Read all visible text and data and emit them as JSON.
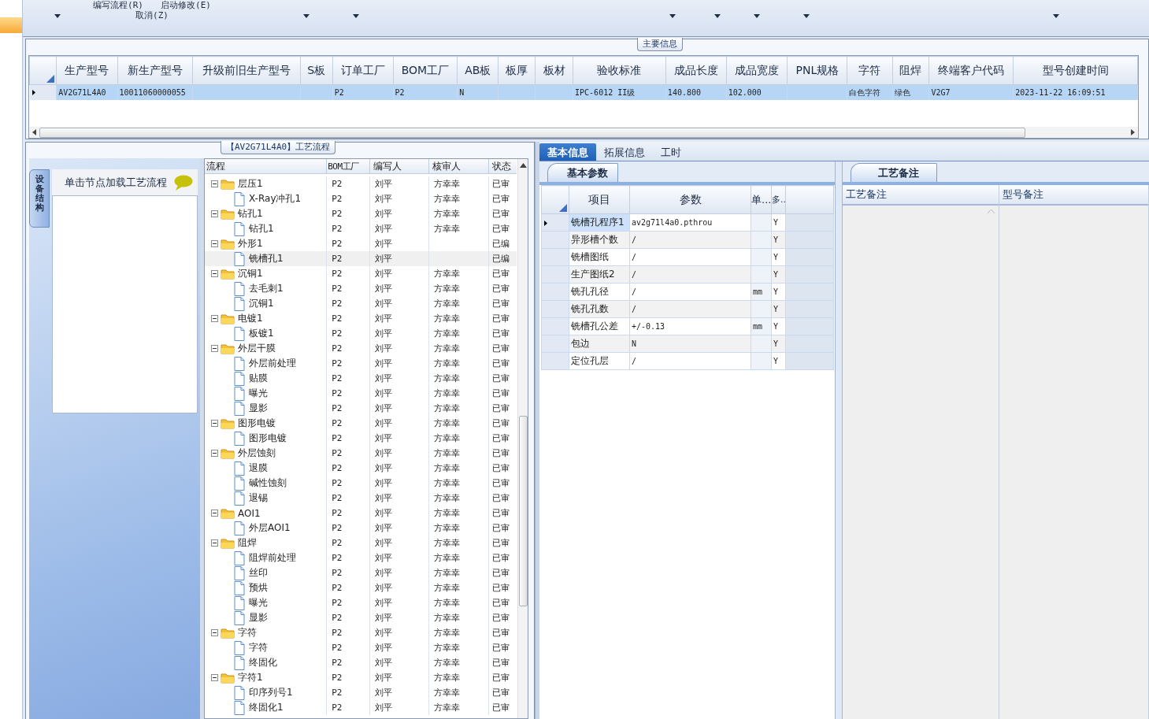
{
  "ribbon": {
    "buttons": [
      {
        "label": "编写流程(R)"
      },
      {
        "label": "启动修改(E)"
      },
      {
        "label": "取消(Z)"
      }
    ]
  },
  "main_info": {
    "title": "主要信息",
    "table": {
      "columns": [
        "生产型号",
        "新生产型号",
        "升级前旧生产型号",
        "S板",
        "订单工厂",
        "BOM工厂",
        "AB板",
        "板厚",
        "板材",
        "验收标准",
        "成品长度",
        "成品宽度",
        "PNL规格",
        "字符",
        "阻焊",
        "终端客户代码",
        "型号创建时间"
      ],
      "rows": [
        {
          "selected": true,
          "cells": [
            "AV2G71L4A0",
            "10011060000055",
            null,
            null,
            "P2",
            "P2",
            "N",
            null,
            null,
            "IPC-6012 II级",
            "140.800",
            "102.000",
            null,
            "白色字符",
            "绿色",
            "V2G7",
            "2023-11-22 16:09:51"
          ]
        }
      ]
    }
  },
  "process": {
    "title": "【AV2G71L4A0】工艺流程",
    "side_tab": "设备结构",
    "hint": "单击节点加载工艺流程",
    "columns": [
      "流程",
      "BOM工厂",
      "编写人",
      "核审人",
      "状态"
    ],
    "tree": [
      {
        "kind": "folder",
        "label": "层压1",
        "bom": "P2",
        "writer": "刘平",
        "reviewer": "方幸幸",
        "status": "已审",
        "expanded": true,
        "selected": false,
        "children": [
          {
            "kind": "file",
            "label": "X-Ray冲孔1",
            "bom": "P2",
            "writer": "刘平",
            "reviewer": "方幸幸",
            "status": "已审",
            "selected": false
          }
        ]
      },
      {
        "kind": "folder",
        "label": "钻孔1",
        "bom": "P2",
        "writer": "刘平",
        "reviewer": "方幸幸",
        "status": "已审",
        "expanded": true,
        "selected": false,
        "children": [
          {
            "kind": "file",
            "label": "钻孔1",
            "bom": "P2",
            "writer": "刘平",
            "reviewer": "方幸幸",
            "status": "已审",
            "selected": false
          }
        ]
      },
      {
        "kind": "folder",
        "label": "外形1",
        "bom": "P2",
        "writer": "刘平",
        "status": "已编",
        "expanded": true,
        "selected": false,
        "children": [
          {
            "kind": "file",
            "label": "铣槽孔1",
            "bom": "P2",
            "writer": "刘平",
            "status": "已编",
            "selected": true
          }
        ]
      },
      {
        "kind": "folder",
        "label": "沉铜1",
        "bom": "P2",
        "writer": "刘平",
        "reviewer": "方幸幸",
        "status": "已审",
        "expanded": true,
        "selected": false,
        "children": [
          {
            "kind": "file",
            "label": "去毛刺1",
            "bom": "P2",
            "writer": "刘平",
            "reviewer": "方幸幸",
            "status": "已审",
            "selected": false
          },
          {
            "kind": "file",
            "label": "沉铜1",
            "bom": "P2",
            "writer": "刘平",
            "reviewer": "方幸幸",
            "status": "已审",
            "selected": false
          }
        ]
      },
      {
        "kind": "folder",
        "label": "电镀1",
        "bom": "P2",
        "writer": "刘平",
        "reviewer": "方幸幸",
        "status": "已审",
        "expanded": true,
        "selected": false,
        "children": [
          {
            "kind": "file",
            "label": "板镀1",
            "bom": "P2",
            "writer": "刘平",
            "reviewer": "方幸幸",
            "status": "已审",
            "selected": false
          }
        ]
      },
      {
        "kind": "folder",
        "label": "外层干膜",
        "bom": "P2",
        "writer": "刘平",
        "reviewer": "方幸幸",
        "status": "已审",
        "expanded": true,
        "selected": false,
        "children": [
          {
            "kind": "file",
            "label": "外层前处理",
            "bom": "P2",
            "writer": "刘平",
            "reviewer": "方幸幸",
            "status": "已审",
            "selected": false
          },
          {
            "kind": "file",
            "label": "贴膜",
            "bom": "P2",
            "writer": "刘平",
            "reviewer": "方幸幸",
            "status": "已审",
            "selected": false
          },
          {
            "kind": "file",
            "label": "曝光",
            "bom": "P2",
            "writer": "刘平",
            "reviewer": "方幸幸",
            "status": "已审",
            "selected": false
          },
          {
            "kind": "file",
            "label": "显影",
            "bom": "P2",
            "writer": "刘平",
            "reviewer": "方幸幸",
            "status": "已审",
            "selected": false
          }
        ]
      },
      {
        "kind": "folder",
        "label": "图形电镀",
        "bom": "P2",
        "writer": "刘平",
        "reviewer": "方幸幸",
        "status": "已审",
        "expanded": true,
        "selected": false,
        "children": [
          {
            "kind": "file",
            "label": "图形电镀",
            "bom": "P2",
            "writer": "刘平",
            "reviewer": "方幸幸",
            "status": "已审",
            "selected": false
          }
        ]
      },
      {
        "kind": "folder",
        "label": "外层蚀刻",
        "bom": "P2",
        "writer": "刘平",
        "reviewer": "方幸幸",
        "status": "已审",
        "expanded": true,
        "selected": false,
        "children": [
          {
            "kind": "file",
            "label": "退膜",
            "bom": "P2",
            "writer": "刘平",
            "reviewer": "方幸幸",
            "status": "已审",
            "selected": false
          },
          {
            "kind": "file",
            "label": "碱性蚀刻",
            "bom": "P2",
            "writer": "刘平",
            "reviewer": "方幸幸",
            "status": "已审",
            "selected": false
          },
          {
            "kind": "file",
            "label": "退锡",
            "bom": "P2",
            "writer": "刘平",
            "reviewer": "方幸幸",
            "status": "已审",
            "selected": false
          }
        ]
      },
      {
        "kind": "folder",
        "label": "AOI1",
        "bom": "P2",
        "writer": "刘平",
        "reviewer": "方幸幸",
        "status": "已审",
        "expanded": true,
        "selected": false,
        "children": [
          {
            "kind": "file",
            "label": "外层AOI1",
            "bom": "P2",
            "writer": "刘平",
            "reviewer": "方幸幸",
            "status": "已审",
            "selected": false
          }
        ]
      },
      {
        "kind": "folder",
        "label": "阻焊",
        "bom": "P2",
        "writer": "刘平",
        "reviewer": "方幸幸",
        "status": "已审",
        "expanded": true,
        "selected": false,
        "children": [
          {
            "kind": "file",
            "label": "阻焊前处理",
            "bom": "P2",
            "writer": "刘平",
            "reviewer": "方幸幸",
            "status": "已审",
            "selected": false
          },
          {
            "kind": "file",
            "label": "丝印",
            "bom": "P2",
            "writer": "刘平",
            "reviewer": "方幸幸",
            "status": "已审",
            "selected": false
          },
          {
            "kind": "file",
            "label": "预烘",
            "bom": "P2",
            "writer": "刘平",
            "reviewer": "方幸幸",
            "status": "已审",
            "selected": false
          },
          {
            "kind": "file",
            "label": "曝光",
            "bom": "P2",
            "writer": "刘平",
            "reviewer": "方幸幸",
            "status": "已审",
            "selected": false
          },
          {
            "kind": "file",
            "label": "显影",
            "bom": "P2",
            "writer": "刘平",
            "reviewer": "方幸幸",
            "status": "已审",
            "selected": false
          }
        ]
      },
      {
        "kind": "folder",
        "label": "字符",
        "bom": "P2",
        "writer": "刘平",
        "reviewer": "方幸幸",
        "status": "已审",
        "expanded": true,
        "selected": false,
        "children": [
          {
            "kind": "file",
            "label": "字符",
            "bom": "P2",
            "writer": "刘平",
            "reviewer": "方幸幸",
            "status": "已审",
            "selected": false
          },
          {
            "kind": "file",
            "label": "终固化",
            "bom": "P2",
            "writer": "刘平",
            "reviewer": "方幸幸",
            "status": "已审",
            "selected": false
          }
        ]
      },
      {
        "kind": "folder",
        "label": "字符1",
        "bom": "P2",
        "writer": "刘平",
        "reviewer": "方幸幸",
        "status": "已审",
        "expanded": true,
        "selected": false,
        "children": [
          {
            "kind": "file",
            "label": "印序列号1",
            "bom": "P2",
            "writer": "刘平",
            "reviewer": "方幸幸",
            "status": "已审",
            "selected": false
          },
          {
            "kind": "file",
            "label": "终固化1",
            "bom": "P2",
            "writer": "刘平",
            "reviewer": "方幸幸",
            "status": "已审",
            "selected": false
          }
        ]
      }
    ]
  },
  "details": {
    "tabs": [
      {
        "label": "基本信息",
        "selected": true
      },
      {
        "label": "拓展信息",
        "selected": false
      },
      {
        "label": "工时",
        "selected": false
      }
    ],
    "params": {
      "tab": "基本参数",
      "columns": [
        "项目",
        "参数",
        "单...",
        "多.."
      ],
      "rows": [
        {
          "item": "铣槽孔程序1",
          "value": "av2g71l4a0.pthrou",
          "flag": "Y",
          "selected": true
        },
        {
          "item": "异形槽个数",
          "value": "/",
          "flag": "Y",
          "selected": false
        },
        {
          "item": "铣槽图纸",
          "value": "/",
          "flag": "Y",
          "selected": false
        },
        {
          "item": "生产图纸2",
          "value": "/",
          "flag": "Y",
          "selected": false
        },
        {
          "item": "铣孔孔径",
          "value": "/",
          "unit": "mm",
          "flag": "Y",
          "selected": false
        },
        {
          "item": "铣孔孔数",
          "value": "/",
          "flag": "Y",
          "selected": false
        },
        {
          "item": "铣槽孔公差",
          "value": "+/-0.13",
          "unit": "mm",
          "flag": "Y",
          "selected": false
        },
        {
          "item": "包边",
          "value": "N",
          "flag": "Y",
          "selected": false
        },
        {
          "item": "定位孔层",
          "value": "/",
          "flag": "Y",
          "selected": false
        }
      ]
    },
    "notes": {
      "tab": "工艺备注",
      "columns": [
        "工艺备注",
        "型号备注"
      ]
    }
  }
}
